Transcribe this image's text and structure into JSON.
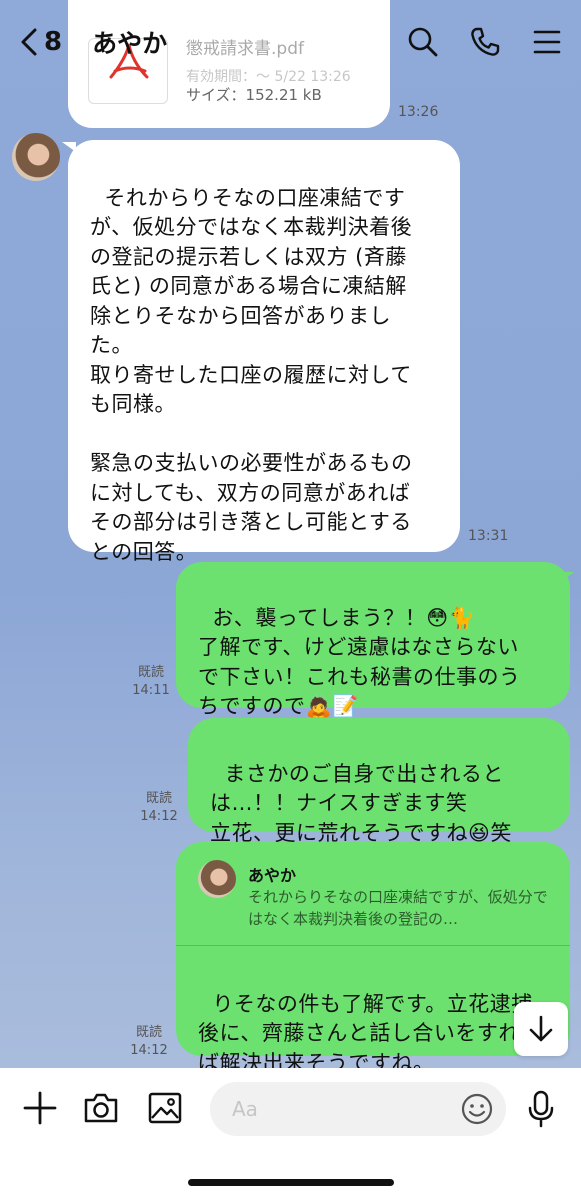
{
  "header": {
    "back_count": "8",
    "chat_name": "あやか"
  },
  "file_message": {
    "file_name": "懲戒請求書.pdf",
    "expiry": "有効期間：～ 5/22 13:26",
    "size": "サイズ：152.21 kB",
    "time": "13:26"
  },
  "messages": [
    {
      "sender": "あやか",
      "text": "それからりそなの口座凍結です\nが、仮処分ではなく本裁判決着後\nの登記の提示若しくは双方 (斉藤\n氏と) の同意がある場合に凍結解\n除とりそなから回答がありまし\nた。\n取り寄せした口座の履歴に対して\nも同様。\n\n緊急の支払いの必要性があるもの\nに対しても、双方の同意があれば\nその部分は引き落とし可能とする\nとの回答。",
      "time": "13:31"
    },
    {
      "sender": "me",
      "text": "お、襲ってしまう？！😳🐈\n了解です、けど遠慮はなさらない\nで下さい！これも秘書の仕事のう\nちですので🙇📝",
      "read": "既読",
      "time": "14:11"
    },
    {
      "sender": "me",
      "text": "まさかのご自身で出されると\nは…！！ナイスすぎます笑\n立花、更に荒れそうですね😆笑",
      "read": "既読",
      "time": "14:12"
    },
    {
      "sender": "me",
      "reply_name": "あやか",
      "reply_text": "それからりそなの口座凍結ですが、仮処分ではなく本裁判決着後の登記の…",
      "text": "りそなの件も了解です。立花逮捕\n後に、齊藤さんと話し合いをすれ\nば解決出来そうですね。",
      "read": "既読",
      "time": "14:12"
    }
  ],
  "input": {
    "placeholder": "Aa"
  },
  "colors": {
    "background": "#8fa9d9",
    "outgoing_bubble": "#6de16f",
    "incoming_bubble": "#ffffff"
  },
  "icons": [
    "back-chevron-icon",
    "search-icon",
    "phone-icon",
    "menu-icon",
    "pdf-icon",
    "plus-icon",
    "camera-icon",
    "image-icon",
    "emoji-icon",
    "microphone-icon",
    "arrow-down-icon"
  ]
}
